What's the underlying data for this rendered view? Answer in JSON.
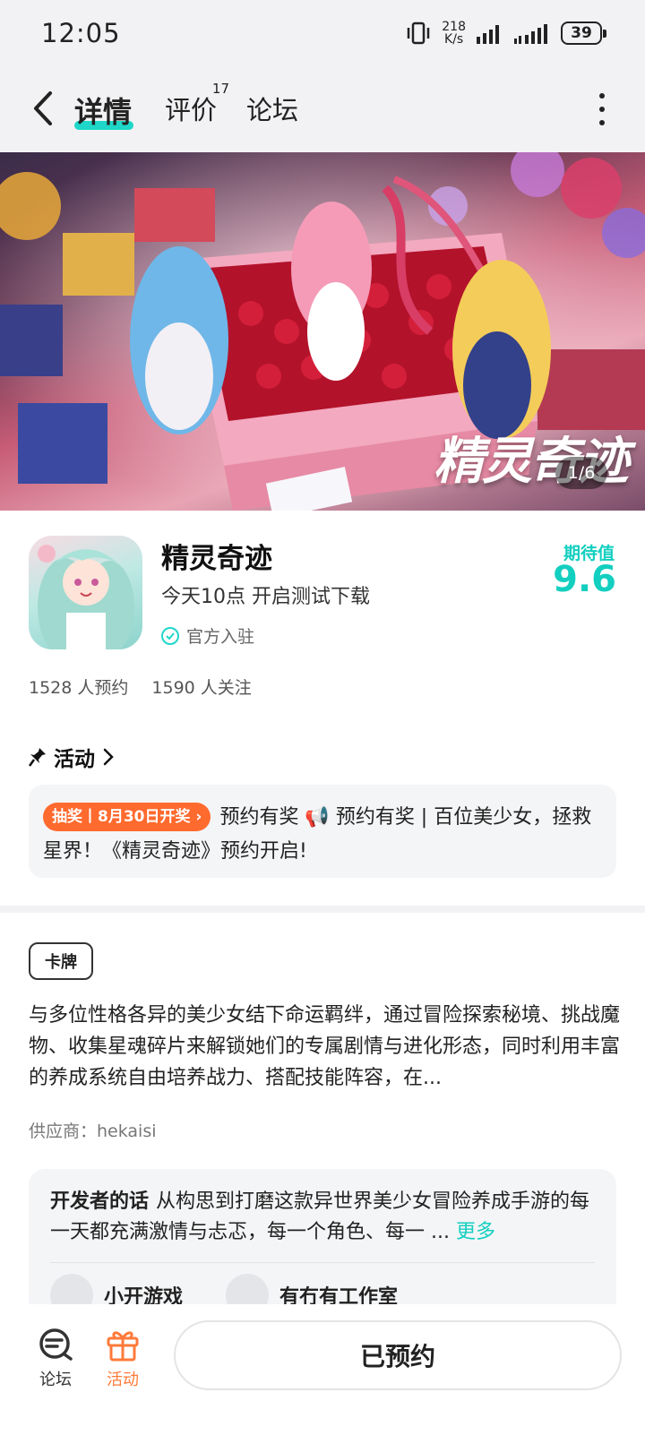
{
  "status_bar": {
    "time": "12:05",
    "net_speed_value": "218",
    "net_speed_unit": "K/s",
    "battery": "39"
  },
  "nav": {
    "tabs": [
      {
        "label": "详情",
        "active": true
      },
      {
        "label": "评价",
        "badge": "17"
      },
      {
        "label": "论坛"
      }
    ],
    "icons": {
      "back": "back-arrow-icon",
      "more": "more-vertical-icon"
    }
  },
  "banner": {
    "logo_text": "精灵奇迹",
    "pager": "1/6"
  },
  "game": {
    "name": "精灵奇迹",
    "subtitle": "今天10点 开启测试下载",
    "official_label": "官方入驻",
    "rating_label": "期待值",
    "rating_value": "9.6",
    "reservations": "1528 人预约",
    "followers": "1590 人关注"
  },
  "activity": {
    "title": "活动",
    "tag": "抽奖丨8月30日开奖",
    "text": "预约有奖 📢 预约有奖 | 百位美少女，拯救星界！《精灵奇迹》预约开启!"
  },
  "details": {
    "genre": "卡牌",
    "description": "与多位性格各异的美少女结下命运羁绊，通过冒险探索秘境、挑战魔物、收集星魂碎片来解锁她们的专属剧情与进化形态，同时利用丰富的养成系统自由培养战力、搭配技能阵容，在...",
    "supplier": "供应商：hekaisi"
  },
  "developer": {
    "heading": "开发者的话",
    "text": "从构思到打磨这款异世界美少女冒险养成手游的每一天都充满激情与忐忑，每一个角色、每一 ...",
    "more": "更多",
    "publishers": [
      "小开游戏",
      "有冇有工作室"
    ]
  },
  "bottom_bar": {
    "forum_label": "论坛",
    "activity_label": "活动",
    "reserve_label": "已预约"
  },
  "colors": {
    "accent": "#13cfc0",
    "tag_orange": "#ff6a2e",
    "activity_orange": "#ff7a3a"
  }
}
